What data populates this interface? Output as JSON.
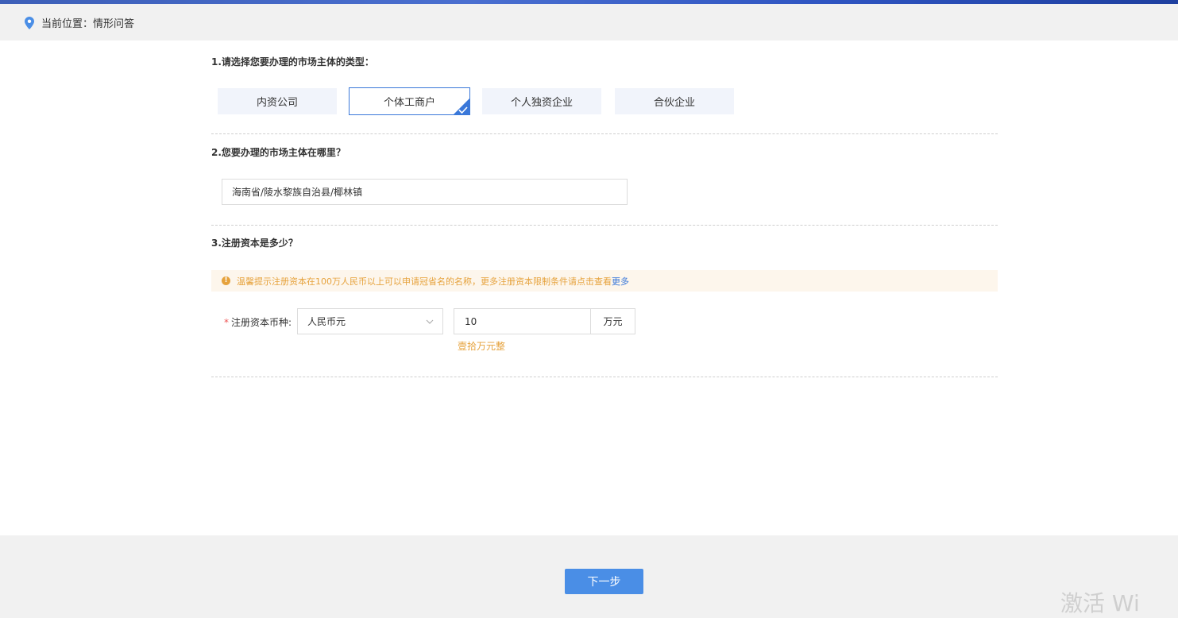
{
  "breadcrumb": {
    "label": "当前位置：情形问答"
  },
  "q1": {
    "title": "1.请选择您要办理的市场主体的类型：",
    "options": [
      "内资公司",
      "个体工商户",
      "个人独资企业",
      "合伙企业"
    ],
    "selected": "个体工商户"
  },
  "q2": {
    "title": "2.您要办理的市场主体在哪里？",
    "value": "海南省/陵水黎族自治县/椰林镇"
  },
  "q3": {
    "title": "3.注册资本是多少？",
    "tip": "温馨提示注册资本在100万人民币以上可以申请冠省名的名称，更多注册资本限制条件请点击查看",
    "tip_link": "更多",
    "currency_label": "注册资本币种:",
    "required_mark": "*",
    "currency_value": "人民币元",
    "amount": "10",
    "unit": "万元",
    "amount_words": "壹拾万元整"
  },
  "footer": {
    "next_label": "下一步"
  },
  "watermark": "激活 Wi",
  "colors": {
    "accent": "#3a78d9",
    "button": "#4a8ee6",
    "warning": "#e6a23c"
  }
}
